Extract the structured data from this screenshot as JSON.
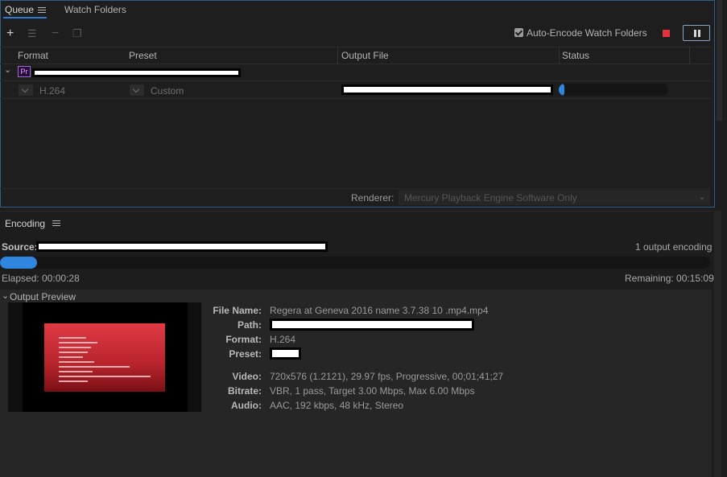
{
  "queue": {
    "tabs": [
      {
        "label": "Queue"
      },
      {
        "label": "Watch Folders"
      }
    ],
    "auto_encode_label": "Auto-Encode Watch Folders",
    "auto_encode_checked": true,
    "columns": {
      "format": "Format",
      "preset": "Preset",
      "output": "Output File",
      "status": "Status"
    },
    "job": {
      "app_badge": "Pr",
      "format": "H.264",
      "preset": "Custom",
      "progress": 0.05
    },
    "renderer_label": "Renderer:",
    "renderer_value": "Mercury Playback Engine Software Only"
  },
  "encoding": {
    "title": "Encoding",
    "source_label": "Source:",
    "output_count": "1 output encoding",
    "progress": 0.052,
    "elapsed": "Elapsed: 00:00:28",
    "remaining": "Remaining: 00:15:09",
    "preview_title": "Output Preview",
    "details": {
      "file_name": {
        "label": "File Name:",
        "value": "Regera at Geneva 2016 name 3.7.38 10  .mp4.mp4"
      },
      "path": {
        "label": "Path:"
      },
      "format": {
        "label": "Format:",
        "value": "H.264"
      },
      "preset": {
        "label": "Preset:"
      },
      "video": {
        "label": "Video:",
        "value": "720x576 (1.2121), 29.97 fps, Progressive, 00;01;41;27"
      },
      "bitrate": {
        "label": "Bitrate:",
        "value": "VBR, 1 pass, Target 3.00 Mbps, Max 6.00 Mbps"
      },
      "audio": {
        "label": "Audio:",
        "value": "AAC, 192 kbps, 48 kHz, Stereo"
      }
    }
  },
  "colors": {
    "accent": "#2e86de",
    "stop": "#e5323b",
    "panel_border": "#2f5d8a"
  }
}
